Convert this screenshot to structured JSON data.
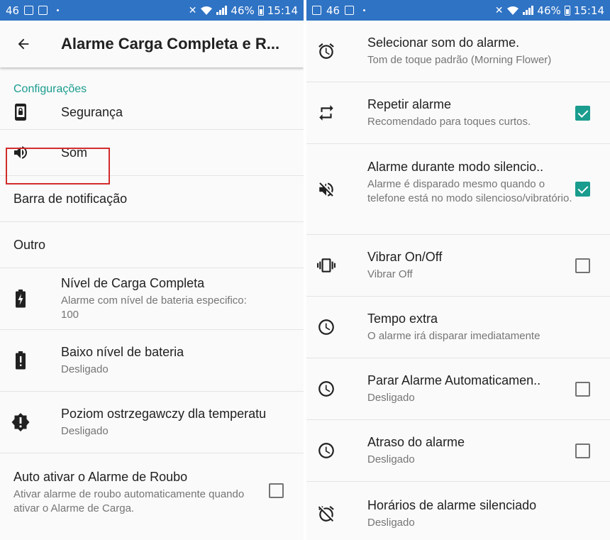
{
  "status_bar": {
    "left_number": "46",
    "battery_percent": "46%",
    "time": "15:14"
  },
  "left_screen": {
    "toolbar": {
      "title": "Alarme Carga Completa e R..."
    },
    "section_header": "Configurações",
    "rows": [
      {
        "title": "Segurança",
        "icon": "phone-lock-icon"
      },
      {
        "title": "Som",
        "icon": "speaker-icon"
      },
      {
        "title": "Barra de notificação"
      },
      {
        "title": "Outro"
      },
      {
        "title": "Nível de Carga Completa",
        "subtitle": "Alarme com nível de bateria especifico: 100",
        "icon": "battery-charging-icon"
      },
      {
        "title": "Baixo nível de bateria",
        "subtitle": "Desligado",
        "icon": "battery-alert-icon"
      },
      {
        "title": "Poziom ostrzegawczy dla temperatu..",
        "subtitle": "Desligado",
        "icon": "temperature-alert-icon"
      },
      {
        "title": "Auto ativar o Alarme de Roubo",
        "subtitle": "Ativar alarme de roubo automaticamente quando ativar o Alarme de Carga.",
        "checked": false
      }
    ]
  },
  "right_screen": {
    "rows": [
      {
        "title": "Selecionar som do alarme.",
        "subtitle": "Tom de toque padrão (Morning Flower)",
        "icon": "alarm-clock-icon"
      },
      {
        "title": "Repetir alarme",
        "subtitle": "Recomendado para toques curtos.",
        "icon": "repeat-icon",
        "checked": true
      },
      {
        "title": "Alarme durante modo silencio..",
        "subtitle": "Alarme é disparado mesmo quando o telefone está no modo silencioso/vibratório.",
        "icon": "volume-off-icon",
        "checked": true
      },
      {
        "title": "Vibrar On/Off",
        "subtitle": "Vibrar Off",
        "icon": "vibrate-icon",
        "checked": false
      },
      {
        "title": "Tempo extra",
        "subtitle": "O alarme irá disparar imediatamente",
        "icon": "clock-icon"
      },
      {
        "title": "Parar Alarme Automaticamen..",
        "subtitle": "Desligado",
        "icon": "clock-icon",
        "checked": false
      },
      {
        "title": "Atraso do alarme",
        "subtitle": "Desligado",
        "icon": "clock-icon",
        "checked": false
      },
      {
        "title": "Horários de alarme silenciado",
        "subtitle": "Desligado",
        "icon": "alarm-off-icon"
      }
    ]
  },
  "colors": {
    "status_bar": "#2f73c4",
    "accent": "#1a9c8e",
    "highlight_box": "#d22c2c"
  }
}
